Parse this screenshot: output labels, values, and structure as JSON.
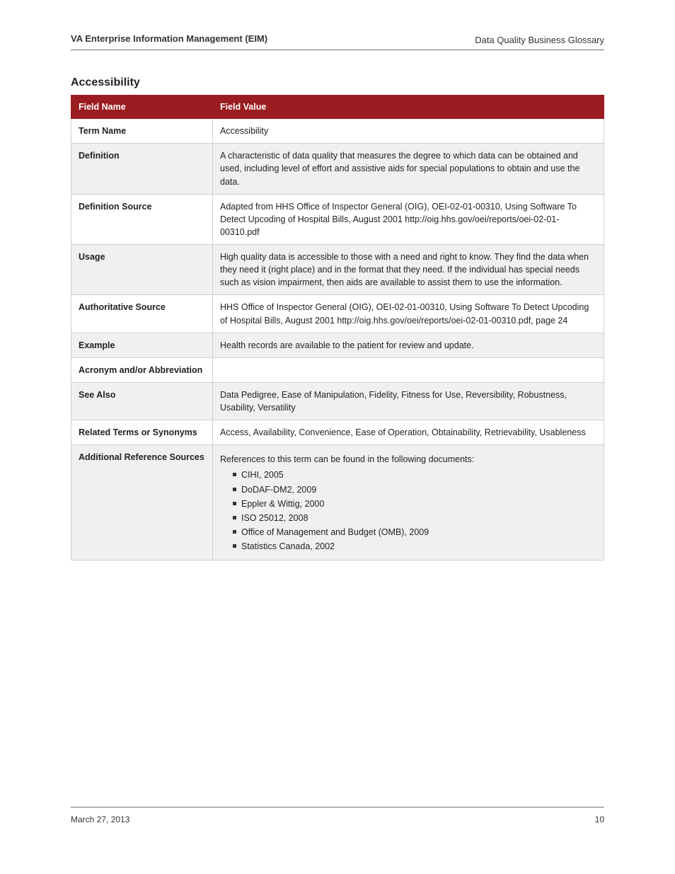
{
  "header": {
    "left": "VA Enterprise Information Management (EIM)",
    "right": "Data Quality Business Glossary"
  },
  "section": {
    "title": "Accessibility"
  },
  "table": {
    "columns": [
      "Field Name",
      "Field Value"
    ],
    "rows": [
      {
        "field": "Term Name",
        "value": "Accessibility",
        "alt": false
      },
      {
        "field": "Definition",
        "value": "A characteristic of data quality that measures the degree to which data can be obtained and used, including level of effort and assistive aids for special populations to obtain and use the data.",
        "alt": true
      },
      {
        "field": "Definition Source",
        "value": "Adapted from HHS Office of Inspector General (OIG), OEI-02-01-00310, Using Software To Detect Upcoding of Hospital Bills, August 2001 http://oig.hhs.gov/oei/reports/oei-02-01-00310.pdf",
        "alt": false
      },
      {
        "field": "Usage",
        "value": "High quality data is accessible to those with a need and right to know. They find the data when they need it (right place) and in the format that they need. If the individual has special needs such as vision impairment, then aids are available to assist them to use the information.",
        "alt": true
      },
      {
        "field": "Authoritative Source",
        "value": "HHS Office of Inspector General (OIG), OEI-02-01-00310, Using Software To Detect Upcoding of Hospital Bills, August 2001 http://oig.hhs.gov/oei/reports/oei-02-01-00310.pdf, page 24",
        "alt": false
      },
      {
        "field": "Example",
        "value": "Health records are available to the patient for review and update.",
        "alt": true
      },
      {
        "field": "Acronym and/or Abbreviation",
        "value": "",
        "alt": false
      },
      {
        "field": "See Also",
        "value": "Data Pedigree, Ease of Manipulation, Fidelity, Fitness for Use, Reversibility, Robustness, Usability, Versatility",
        "alt": true
      },
      {
        "field": "Related Terms or Synonyms",
        "value": "Access, Availability, Convenience, Ease of Operation, Obtainability, Retrievability, Usableness",
        "alt": false
      },
      {
        "field": "Additional Reference Sources",
        "pre": "References to this term can be found in the following documents:",
        "bullets": [
          "CIHI, 2005",
          "DoDAF-DM2, 2009",
          "Eppler & Wittig, 2000",
          "ISO 25012, 2008",
          "Office of Management and Budget (OMB), 2009",
          "Statistics Canada, 2002"
        ],
        "alt": true
      }
    ]
  },
  "footer": {
    "left": "March 27, 2013",
    "right": "10"
  }
}
